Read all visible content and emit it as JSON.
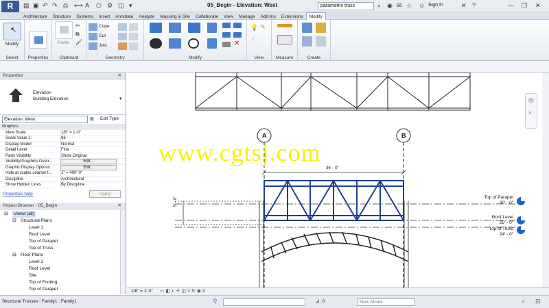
{
  "app": {
    "logo": "R",
    "title": "05_Begin - Elevation: West",
    "search_placeholder": "parametric truss",
    "user_label": "Sign In"
  },
  "tabs": [
    "Architecture",
    "Structure",
    "Systems",
    "Insert",
    "Annotate",
    "Analyze",
    "Massing & Site",
    "Collaborate",
    "View",
    "Manage",
    "Add-Ins",
    "Extensions",
    "Modify"
  ],
  "active_tab": "Modify",
  "ribbon": {
    "modify_label": "Modify",
    "panels": [
      "Select",
      "Properties",
      "Clipboard",
      "Geometry",
      "Modify",
      "View",
      "Measure",
      "Create"
    ],
    "geometry_items": [
      "Cope",
      "Cut",
      "Join"
    ],
    "paste_label": "Paste"
  },
  "properties": {
    "header": "Properties",
    "type_name": "Elevation",
    "type_sub": "Building Elevation",
    "selector": "Elevation: West",
    "edit_type": "Edit Type",
    "group": "Graphics",
    "rows": [
      {
        "k": "View Scale",
        "v": "1/8\" = 1'-0\""
      },
      {
        "k": "Scale Value    1:",
        "v": "96"
      },
      {
        "k": "Display Model",
        "v": "Normal"
      },
      {
        "k": "Detail Level",
        "v": "Fine"
      },
      {
        "k": "Parts Visibility",
        "v": "Show Original"
      },
      {
        "k": "Visibility/Graphics Overr...",
        "v": "Edit..."
      },
      {
        "k": "Graphic Display Options",
        "v": "Edit..."
      },
      {
        "k": "Hide at scales coarser t...",
        "v": "1\" = 400'-0\""
      },
      {
        "k": "Discipline",
        "v": "Architectural"
      },
      {
        "k": "Show Hidden Lines",
        "v": "By Discipline"
      }
    ],
    "help": "Properties help",
    "apply": "Apply"
  },
  "browser": {
    "header": "Project Browser - 05_Begin",
    "items": [
      {
        "label": "Views (all)",
        "level": 0,
        "sym": "-"
      },
      {
        "label": "Structural Plans",
        "level": 1,
        "sym": "-"
      },
      {
        "label": "Level 1",
        "level": 2
      },
      {
        "label": "Roof Level",
        "level": 2
      },
      {
        "label": "Top of Parapet",
        "level": 2
      },
      {
        "label": "Top of Truss",
        "level": 2
      },
      {
        "label": "Floor Plans",
        "level": 1,
        "sym": "-"
      },
      {
        "label": "Level 1",
        "level": 2
      },
      {
        "label": "Roof Level",
        "level": 2
      },
      {
        "label": "Site",
        "level": 2
      },
      {
        "label": "Top of Footing",
        "level": 2
      },
      {
        "label": "Top of Parapet",
        "level": 2
      }
    ]
  },
  "drawing": {
    "grid_a": "A",
    "grid_b": "B",
    "dim_top": "36' - 0\"",
    "dim_left": "5' - 0\"",
    "watermark": "www.cgtsj.com",
    "levels": [
      {
        "name": "Top of Parapet",
        "elev": "30' - 0\""
      },
      {
        "name": "Roof Level",
        "elev": "25' - 0\""
      },
      {
        "name": "Top of Truss",
        "elev": "24' - 0\""
      }
    ]
  },
  "viewbar": {
    "scale": "1/8\" = 1'-0\""
  },
  "status": {
    "text": "Structural Trusses : Family1 : Family1",
    "model": "Main Model",
    "count": ":0"
  },
  "colors": {
    "selection": "#1f3f8f",
    "ribbon_blue": "#3a78c9",
    "watermark": "#f6f20a"
  }
}
